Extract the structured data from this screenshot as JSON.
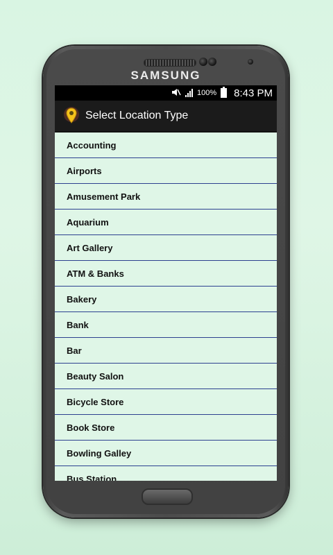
{
  "device": {
    "brand": "SAMSUNG"
  },
  "status_bar": {
    "battery_percent": "100%",
    "time": "8:43 PM",
    "icons": [
      "mute-icon",
      "signal-icon",
      "battery-icon"
    ]
  },
  "action_bar": {
    "icon": "location-pin-icon",
    "title": "Select Location Type"
  },
  "colors": {
    "list_background": "#dff6e7",
    "divider": "#2b3f8f",
    "action_bar": "#1b1b1b",
    "pin": "#f5c21b"
  },
  "location_types": [
    {
      "label": "Accounting"
    },
    {
      "label": "Airports"
    },
    {
      "label": "Amusement Park"
    },
    {
      "label": "Aquarium"
    },
    {
      "label": "Art Gallery"
    },
    {
      "label": "ATM & Banks"
    },
    {
      "label": "Bakery"
    },
    {
      "label": "Bank"
    },
    {
      "label": "Bar"
    },
    {
      "label": "Beauty Salon"
    },
    {
      "label": "Bicycle Store"
    },
    {
      "label": "Book Store"
    },
    {
      "label": "Bowling Galley"
    },
    {
      "label": "Bus Station"
    }
  ]
}
